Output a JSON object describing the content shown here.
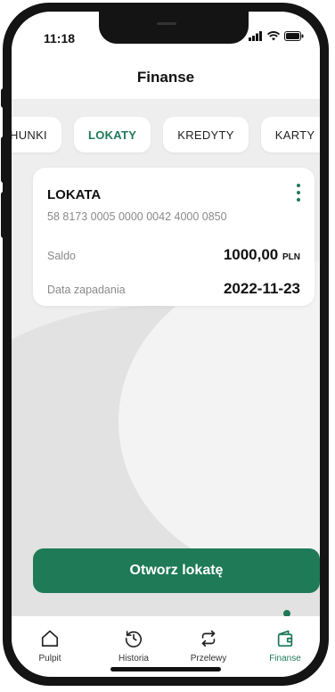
{
  "status_bar": {
    "time": "11:18"
  },
  "header": {
    "title": "Finanse"
  },
  "tabs": [
    {
      "label": "HUNKI",
      "active": false
    },
    {
      "label": "LOKATY",
      "active": true
    },
    {
      "label": "KREDYTY",
      "active": false
    },
    {
      "label": "KARTY",
      "active": false
    }
  ],
  "deposit_card": {
    "title": "LOKATA",
    "account_number": "58 8173 0005 0000 0042 4000 0850",
    "balance_label": "Saldo",
    "balance_value": "1000,00",
    "balance_currency": "PLN",
    "maturity_label": "Data zapadania",
    "maturity_value": "2022-11-23",
    "menu_icon": "more-vertical-icon"
  },
  "cta": {
    "label": "Otworz lokatę"
  },
  "bottom_nav": {
    "items": [
      {
        "label": "Pulpit",
        "icon": "home-icon",
        "active": false
      },
      {
        "label": "Historia",
        "icon": "history-icon",
        "active": false
      },
      {
        "label": "Przelewy",
        "icon": "transfer-icon",
        "active": false
      },
      {
        "label": "Finanse",
        "icon": "wallet-icon",
        "active": true
      }
    ]
  },
  "colors": {
    "accent": "#1f7a58",
    "background": "#eeeeee",
    "card": "#ffffff"
  }
}
